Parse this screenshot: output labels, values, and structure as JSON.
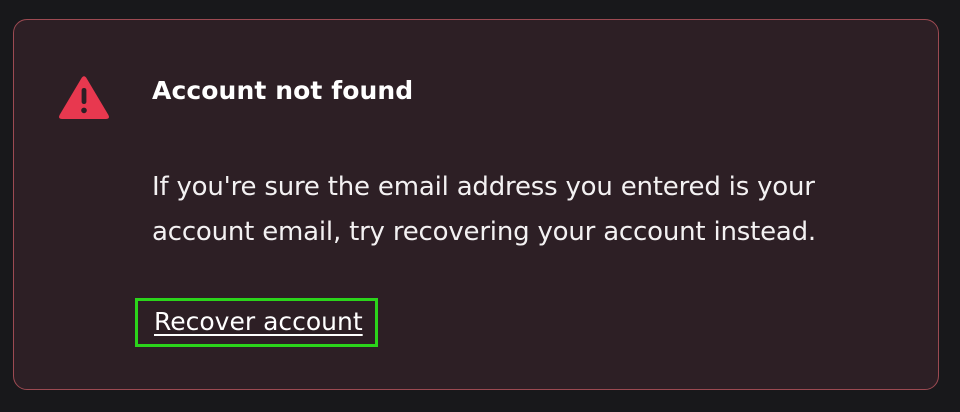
{
  "alert": {
    "icon": "warning-triangle-icon",
    "icon_color": "#e8384f",
    "border_color": "#9c4a52",
    "background_color": "#2d1f25",
    "title": "Account not found",
    "message": "If you're sure the email address you entered is your account email, try recovering your account instead.",
    "link_label": "Recover account",
    "focus_ring_color": "#2bd41b"
  }
}
